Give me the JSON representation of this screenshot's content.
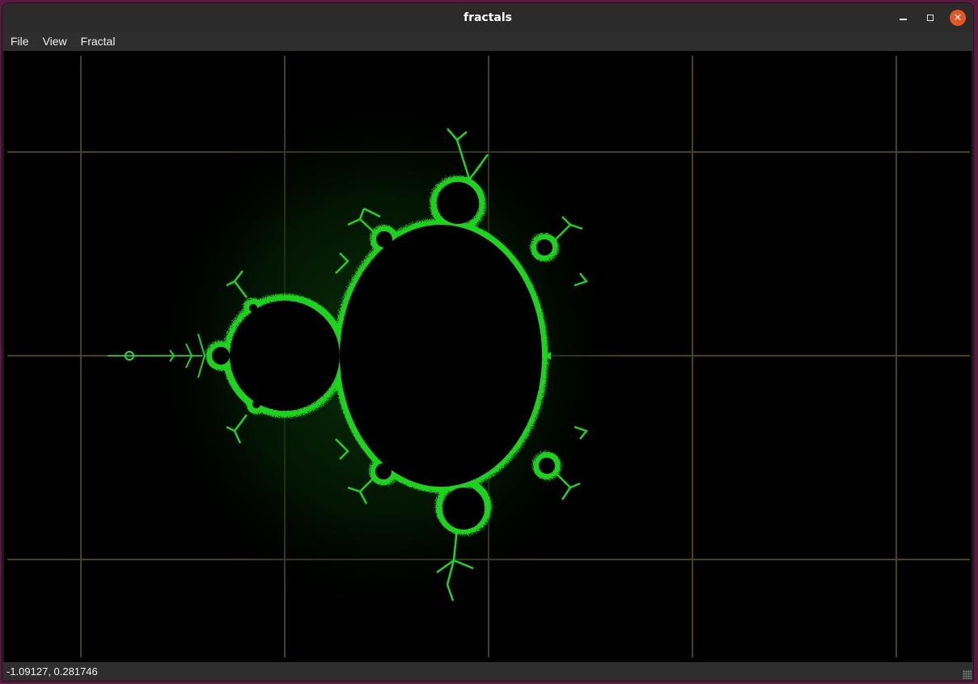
{
  "window": {
    "title": "fractals"
  },
  "menu": {
    "items": [
      "File",
      "View",
      "Fractal"
    ]
  },
  "fractal": {
    "name": "Mandelbrot",
    "palette": {
      "background": "#000000",
      "set": "#000000",
      "edge": "#1fd41f",
      "grid": "#4a4410"
    }
  },
  "status": {
    "coordinates": "-1.09127, 0.281746"
  },
  "icons": {
    "minimize": "minimize-icon",
    "maximize": "maximize-icon",
    "close": "close-icon",
    "resize": "resize-grip-icon"
  }
}
